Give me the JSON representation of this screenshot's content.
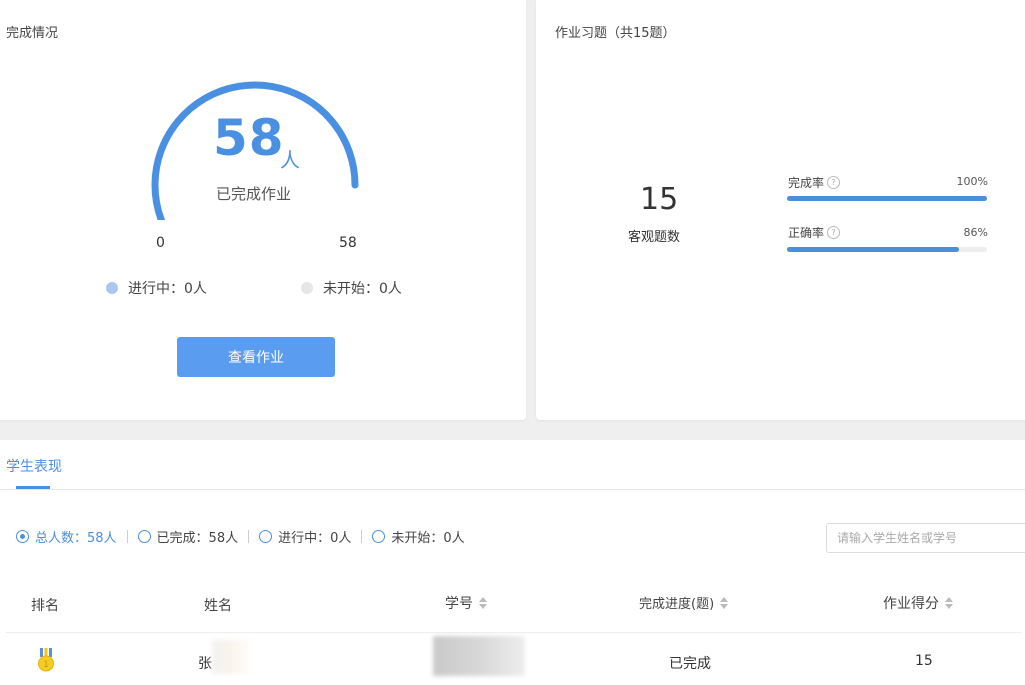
{
  "completion": {
    "title": "完成情况",
    "count": "58",
    "unit": "人",
    "caption": "已完成作业",
    "min_label": "0",
    "max_label": "58",
    "progress_fraction": 1.0,
    "in_progress": "进行中：0人",
    "not_started": "未开始：0人",
    "view_button": "查看作业",
    "colors": {
      "arc": "#4a90e2",
      "in_progress_dot": "#a9c8ee",
      "not_started_dot": "#e6e6e6",
      "button": "#5a9cf0"
    }
  },
  "exercises": {
    "title": "作业习题（共15题）",
    "objective_count": "15",
    "objective_label": "客观题数",
    "metrics": [
      {
        "label": "完成率",
        "value": "100%",
        "fraction": 1.0
      },
      {
        "label": "正确率",
        "value": "86%",
        "fraction": 0.86
      }
    ],
    "help_icon": "?"
  },
  "students": {
    "tab_label": "学生表现",
    "filters": [
      {
        "label": "总人数：58人",
        "checked": true
      },
      {
        "label": "已完成：58人",
        "checked": false
      },
      {
        "label": "进行中：0人",
        "checked": false
      },
      {
        "label": "未开始：0人",
        "checked": false
      }
    ],
    "search_placeholder": "请输入学生姓名或学号",
    "columns": [
      "排名",
      "姓名",
      "学号",
      "完成进度(题)",
      "作业得分"
    ],
    "rows": [
      {
        "rank_icon": "gold-medal-icon",
        "name": "张",
        "student_id": "",
        "progress": "已完成",
        "score": "15"
      }
    ]
  }
}
